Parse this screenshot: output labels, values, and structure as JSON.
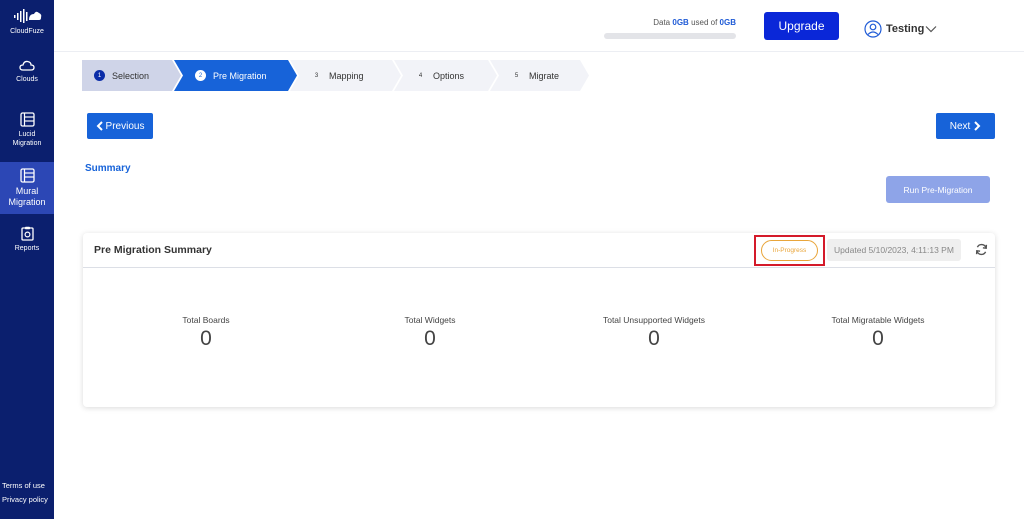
{
  "sidebar": {
    "brand": "CloudFuze",
    "items": [
      {
        "label": "Clouds",
        "icon": "cloud-icon"
      },
      {
        "label_line1": "Lucid",
        "label_line2": "Migration",
        "icon": "board-icon"
      },
      {
        "label_line1": "Mural",
        "label_line2": "Migration",
        "icon": "board-icon"
      },
      {
        "label": "Reports",
        "icon": "report-icon"
      }
    ],
    "links": {
      "terms": "Terms of use",
      "privacy": "Privacy policy"
    }
  },
  "header": {
    "storage": {
      "prefix": "Data",
      "used": "0GB",
      "middle": "used of",
      "total": "0GB",
      "used_fraction": 0
    },
    "upgrade_label": "Upgrade",
    "user_name": "Testing"
  },
  "steps": [
    {
      "num": "1",
      "label": "Selection"
    },
    {
      "num": "2",
      "label": "Pre Migration"
    },
    {
      "num": "3",
      "label": "Mapping"
    },
    {
      "num": "4",
      "label": "Options"
    },
    {
      "num": "5",
      "label": "Migrate"
    }
  ],
  "nav": {
    "previous_label": "Previous",
    "next_label": "Next"
  },
  "summary_title": "Summary",
  "run_pre_migration_label": "Run Pre-Migration",
  "card": {
    "title": "Pre Migration Summary",
    "status": "In-Progress",
    "updated": "Updated 5/10/2023, 4:11:13 PM",
    "stats": [
      {
        "label": "Total Boards",
        "value": "0"
      },
      {
        "label": "Total Widgets",
        "value": "0"
      },
      {
        "label": "Total Unsupported Widgets",
        "value": "0"
      },
      {
        "label": "Total Migratable Widgets",
        "value": "0"
      }
    ]
  },
  "colors": {
    "sidebar": "#0b1f6e",
    "accent": "#1763d9",
    "upgrade": "#0a27d8",
    "status": "#e9a53a",
    "highlight": "#d41a2a"
  }
}
